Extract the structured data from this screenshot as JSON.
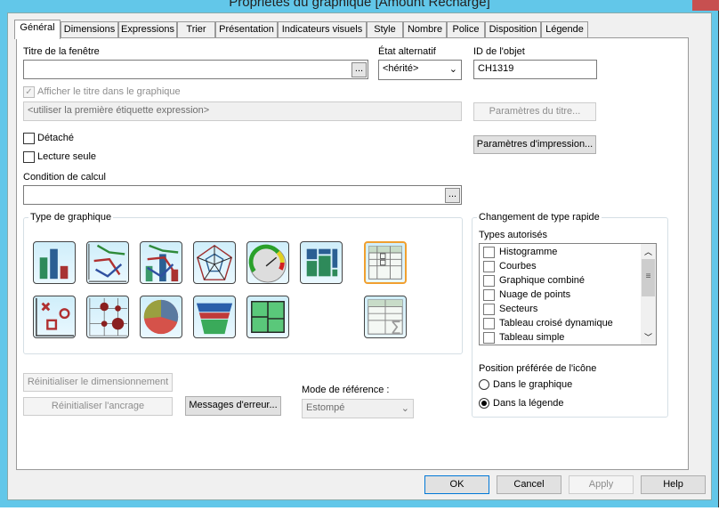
{
  "window": {
    "title": "Propriétés du graphique [Amount Recharge]"
  },
  "tabs": [
    "Général",
    "Dimensions",
    "Expressions",
    "Trier",
    "Présentation",
    "Indicateurs visuels",
    "Style",
    "Nombre",
    "Police",
    "Disposition",
    "Légende"
  ],
  "general": {
    "window_title_label": "Titre de la fenêtre",
    "window_title_value": "",
    "browse": "...",
    "alt_state_label": "État alternatif",
    "alt_state_value": "<hérité>",
    "object_id_label": "ID de l'objet",
    "object_id_value": "CH1319",
    "show_title_label": "Afficher le titre dans le graphique",
    "title_placeholder": "<utiliser la première étiquette expression>",
    "title_params": "Paramètres du titre...",
    "print_params": "Paramètres d'impression...",
    "detached": "Détaché",
    "readonly": "Lecture seule",
    "calc_condition_label": "Condition de calcul",
    "calc_condition_value": "",
    "chart_type_label": "Type de graphique",
    "chart_types": [
      "bar-chart",
      "line-chart",
      "combo-chart",
      "radar-chart",
      "gauge-chart",
      "mekko-chart",
      "pivot-table",
      "scatter-chart",
      "grid-chart",
      "pie-chart",
      "funnel-chart",
      "block-chart",
      "straight-table"
    ],
    "quick_change_label": "Changement de type rapide",
    "allowed_types_label": "Types autorisés",
    "allowed_types": [
      "Histogramme",
      "Courbes",
      "Graphique combiné",
      "Nuage de points",
      "Secteurs",
      "Tableau croisé dynamique",
      "Tableau simple"
    ],
    "icon_pos_label": "Position préférée de l'icône",
    "icon_pos_options": [
      "Dans le graphique",
      "Dans la légende"
    ],
    "icon_pos_selected": "Dans la légende",
    "reset_size": "Réinitialiser le dimensionnement",
    "reset_anchor": "Réinitialiser l'ancrage",
    "error_messages": "Messages d'erreur...",
    "ref_mode_label": "Mode de référence :",
    "ref_mode_value": "Estompé"
  },
  "footer": {
    "ok": "OK",
    "cancel": "Cancel",
    "apply": "Apply",
    "help": "Help"
  }
}
